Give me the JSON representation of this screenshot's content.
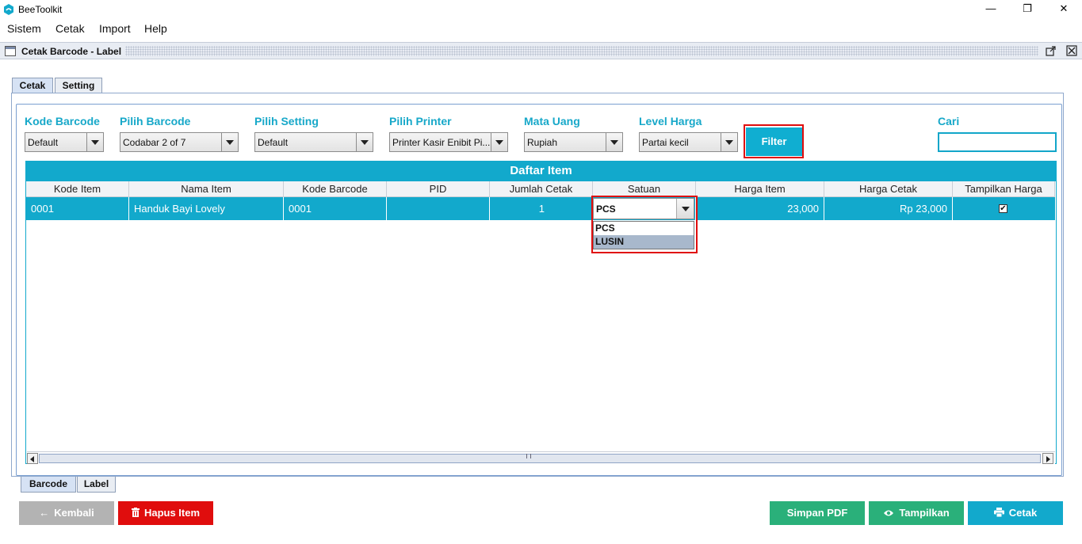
{
  "window": {
    "title": "BeeToolkit",
    "minimize": "—",
    "restore": "❐",
    "close": "✕"
  },
  "menu": [
    "Sistem",
    "Cetak",
    "Import",
    "Help"
  ],
  "frame": {
    "title": "Cetak Barcode - Label",
    "icon": "window-icon"
  },
  "tabs": {
    "top": [
      "Cetak",
      "Setting"
    ],
    "bottom": [
      "Barcode",
      "Label"
    ]
  },
  "filters": {
    "kode_barcode": {
      "label": "Kode Barcode",
      "value": "Default"
    },
    "pilih_barcode": {
      "label": "Pilih Barcode",
      "value": "Codabar 2 of 7"
    },
    "pilih_setting": {
      "label": "Pilih Setting",
      "value": "Default"
    },
    "pilih_printer": {
      "label": "Pilih Printer",
      "value": "Printer Kasir Enibit Pi..."
    },
    "mata_uang": {
      "label": "Mata Uang",
      "value": "Rupiah"
    },
    "level_harga": {
      "label": "Level Harga",
      "value": "Partai kecil"
    },
    "filter_button": "Filter",
    "cari": {
      "label": "Cari",
      "value": ""
    }
  },
  "table": {
    "title": "Daftar Item",
    "columns": [
      "Kode Item",
      "Nama Item",
      "Kode Barcode",
      "PID",
      "Jumlah Cetak",
      "Satuan",
      "Harga Item",
      "Harga Cetak",
      "Tampilkan Harga"
    ],
    "rows": [
      {
        "kode_item": "0001",
        "nama_item": "Handuk Bayi Lovely",
        "kode_barcode": "0001",
        "pid": "",
        "jumlah_cetak": "1",
        "satuan": "PCS",
        "harga_item": "23,000",
        "harga_cetak": "Rp 23,000",
        "tampilkan_harga": "✔"
      }
    ],
    "satuan_options": [
      "PCS",
      "LUSIN"
    ]
  },
  "buttons": {
    "kembali": "Kembali",
    "hapus": "Hapus Item",
    "simpan_pdf": "Simpan PDF",
    "tampilkan": "Tampilkan",
    "cetak": "Cetak"
  },
  "colors": {
    "accent": "#12a9cc",
    "danger": "#e00d0d",
    "green": "#2ab07a",
    "gray": "#b3b3b3",
    "highlight": "#e00d0d"
  }
}
